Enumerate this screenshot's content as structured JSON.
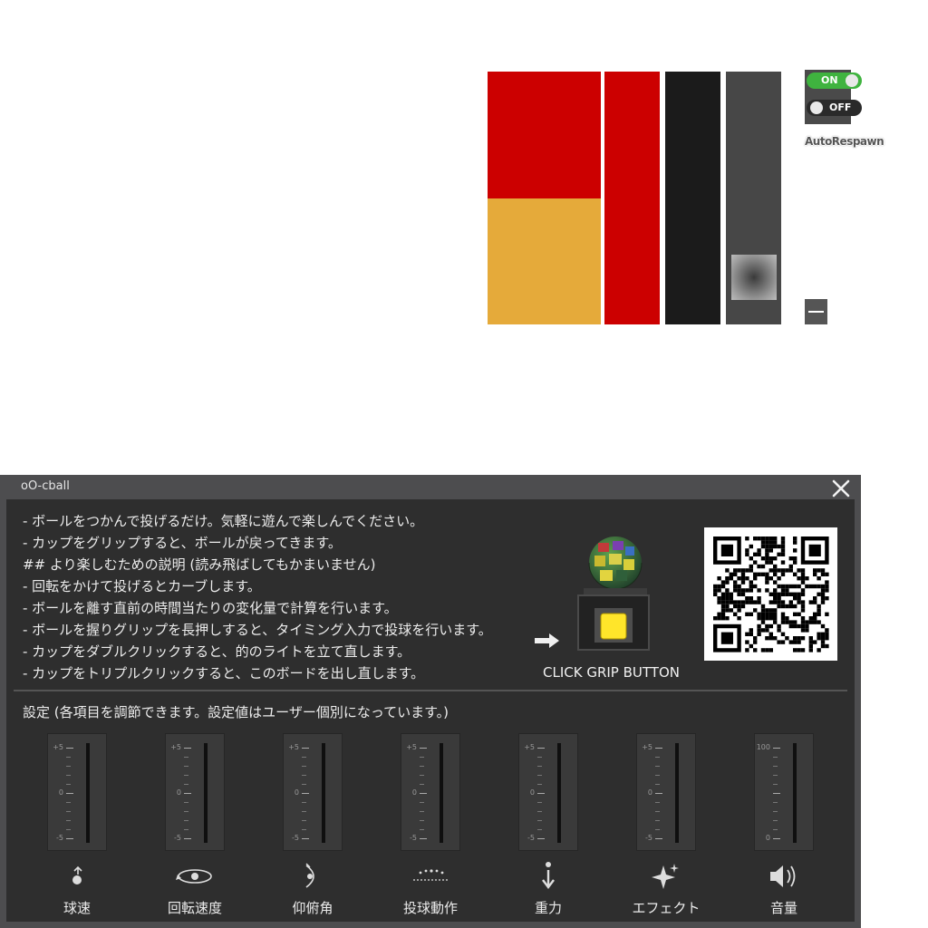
{
  "colors": {
    "red": "#cc0000",
    "gold": "#e5aa3a",
    "black": "#1b1b1b",
    "gray": "#474747",
    "board_bg": "#2e2e2e",
    "toggle_on": "#3fb33f"
  },
  "auto_respawn": {
    "on_label": "ON",
    "off_label": "OFF",
    "label": "AutoRespawn"
  },
  "board": {
    "title": "oO-cball",
    "instructions": [
      "- ボールをつかんで投げるだけ。気軽に遊んで楽しんでください。",
      "- カップをグリップすると、ボールが戻ってきます。",
      "## より楽しむための説明 (読み飛ばしてもかまいません)",
      "- 回転をかけて投げるとカーブします。",
      "- ボールを離す直前の時間当たりの変化量で計算を行います。",
      "- ボールを握りグリップを長押しすると、タイミング入力で投球を行います。",
      "- カップをダブルクリックすると、的のライトを立て直します。",
      "- カップをトリプルクリックすると、このボードを出し直します。"
    ],
    "grip_label": "CLICK GRIP BUTTON",
    "settings_title": "設定 (各項目を調節できます。設定値はユーザー個別になっています。)",
    "sliders": [
      {
        "label": "球速",
        "icon": "ball-speed-icon",
        "max": "+5",
        "mid": "0",
        "min": "-5"
      },
      {
        "label": "回転速度",
        "icon": "rotation-icon",
        "max": "+5",
        "mid": "0",
        "min": "-5"
      },
      {
        "label": "仰俯角",
        "icon": "angle-icon",
        "max": "+5",
        "mid": "0",
        "min": "-5"
      },
      {
        "label": "投球動作",
        "icon": "pitch-motion-icon",
        "max": "+5",
        "mid": "0",
        "min": "-5"
      },
      {
        "label": "重力",
        "icon": "gravity-icon",
        "max": "+5",
        "mid": "0",
        "min": "-5"
      },
      {
        "label": "エフェクト",
        "icon": "sparkle-icon",
        "max": "+5",
        "mid": "0",
        "min": "-5"
      },
      {
        "label": "音量",
        "icon": "speaker-icon",
        "max": "100",
        "mid": "",
        "min": "0"
      }
    ]
  }
}
